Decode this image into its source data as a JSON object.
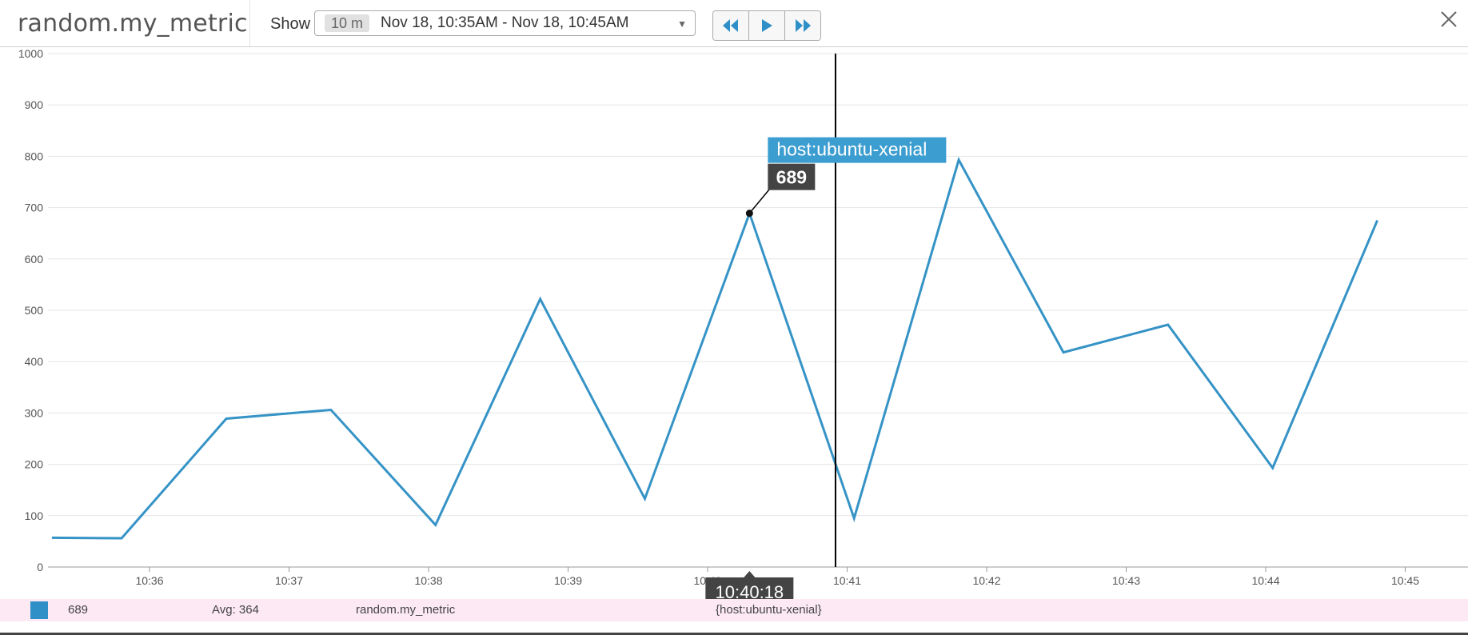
{
  "header": {
    "title": "random.my_metric",
    "show_label": "Show",
    "range_chip": "10 m",
    "range_text": "Nov 18, 10:35AM - Nov 18, 10:45AM",
    "buttons": {
      "rewind": "rewind-icon",
      "play": "play-icon",
      "forward": "fast-forward-icon",
      "close": "close-icon"
    }
  },
  "colors": {
    "series": "#3593c6",
    "tooltip_label_bg": "#3c9dd0",
    "tooltip_value_bg": "#444444",
    "legend_bg": "#fce9f4",
    "grid": "#e5e5e5"
  },
  "chart_data": {
    "type": "line",
    "ylim": [
      0,
      1000
    ],
    "y_ticks": [
      0,
      100,
      200,
      300,
      400,
      500,
      600,
      700,
      800,
      900,
      1000
    ],
    "x_ticks": [
      "10:36",
      "10:37",
      "10:38",
      "10:39",
      "10:40",
      "10:41",
      "10:42",
      "10:43",
      "10:44",
      "10:45"
    ],
    "series": [
      {
        "x": [
          "10:35:18",
          "10:35:48",
          "10:36:33",
          "10:37:18",
          "10:38:03",
          "10:38:48",
          "10:39:33",
          "10:40:18",
          "10:41:03",
          "10:41:48",
          "10:42:33",
          "10:43:18",
          "10:44:03",
          "10:44:48"
        ],
        "values": [
          57,
          56,
          289,
          306,
          82,
          522,
          133,
          689,
          95,
          793,
          418,
          472,
          193,
          675
        ]
      }
    ],
    "crosshair_time": "10:40:55",
    "hover": {
      "time": "10:40:18",
      "label": "host:ubuntu-xenial",
      "value": "689"
    },
    "legend": {
      "value": "689",
      "avg": "Avg: 364",
      "metric": "random.my_metric",
      "scope": "{host:ubuntu-xenial}"
    }
  }
}
